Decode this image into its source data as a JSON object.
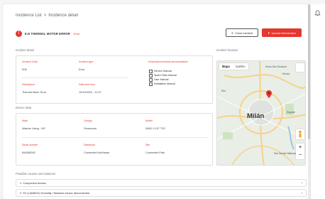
{
  "breadcrumb": {
    "items": [
      "Incidence List",
      "Incidence detail"
    ],
    "separator": ">"
  },
  "incident": {
    "code": "E.N THERMAL MOTOR ERROR",
    "status": "Error",
    "status_color": "#e5372e",
    "close_button": "Close incident",
    "upload_button": "Upload intervention"
  },
  "incident_details": {
    "section_title": "Incident detail",
    "fields": [
      {
        "label": "Incident Code",
        "value": "E06"
      },
      {
        "label": "Incident type",
        "value": "Error"
      },
      {
        "label": "Description",
        "value": "Thermal Motor Error"
      },
      {
        "label": "Date and hour",
        "value": "10/10/2022 - 12:07"
      }
    ],
    "docs_title": "Download technical documentation",
    "docs": [
      "Service Manual",
      "Spare Parts Manual",
      "User Manual",
      "Installation Manual"
    ]
  },
  "device_data": {
    "section_title": "Device data",
    "fields": [
      {
        "label": "Mark",
        "value": "Washer Using - WY"
      },
      {
        "label": "Groups",
        "value": "Showroom"
      },
      {
        "label": "Model",
        "value": "WNG 9 157 TS2"
      },
      {
        "label": "Serial number",
        "value": "844565342"
      },
      {
        "label": "Distributor",
        "value": "Connected Northeast"
      },
      {
        "label": "Site",
        "value": "Connected Park"
      }
    ]
  },
  "location": {
    "section_title": "Incident location",
    "map_tabs": [
      "Mapa",
      "Satélite"
    ],
    "city": "Milán",
    "labels": [
      "Sesto San Giovanni",
      "Monza",
      "Segrate",
      "San Donato Milanese",
      "Rho"
    ],
    "pin_color": "#e5372e"
  },
  "causes": {
    "section_title": "Possible causes and solutions",
    "items": [
      "1. Component Access",
      "2. SV (LAN8024) Humidity / Moisture sensor disconnected"
    ]
  },
  "icons": {
    "notification": "bell-icon",
    "close": "x-icon",
    "upload": "upload-icon",
    "document": "document-icon",
    "chevron": "chevron-right-icon",
    "pin": "map-pin-icon"
  }
}
